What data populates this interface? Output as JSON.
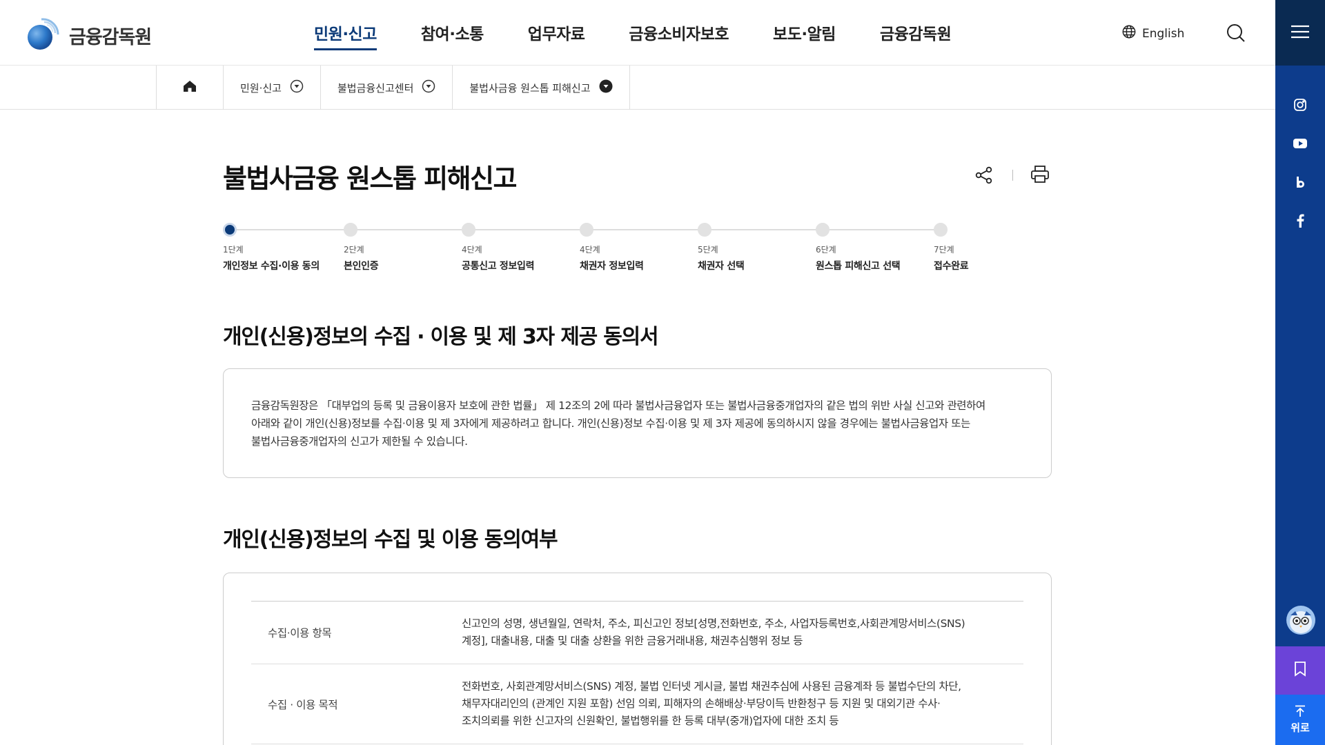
{
  "header": {
    "logo_text": "금융감독원",
    "nav": [
      {
        "label": "민원·신고",
        "active": true
      },
      {
        "label": "참여·소통",
        "active": false
      },
      {
        "label": "업무자료",
        "active": false
      },
      {
        "label": "금융소비자보호",
        "active": false
      },
      {
        "label": "보도·알림",
        "active": false
      },
      {
        "label": "금융감독원",
        "active": false
      }
    ],
    "language": "English"
  },
  "breadcrumb": {
    "items": [
      "민원·신고",
      "불법금융신고센터",
      "불법사금융 원스톱 피해신고"
    ]
  },
  "rail": {
    "top_button_label": "위로"
  },
  "page": {
    "title": "불법사금융 원스톱 피해신고"
  },
  "steps": [
    {
      "num": "1단계",
      "label": "개인정보 수집·이용 동의",
      "active": true
    },
    {
      "num": "2단계",
      "label": "본인인증",
      "active": false
    },
    {
      "num": "4단계",
      "label": "공통신고 정보입력",
      "active": false
    },
    {
      "num": "4단계",
      "label": "채권자 정보입력",
      "active": false
    },
    {
      "num": "5단계",
      "label": "채권자 선택",
      "active": false
    },
    {
      "num": "6단계",
      "label": "원스톱 피해신고 선택",
      "active": false
    },
    {
      "num": "7단계",
      "label": "접수완료",
      "active": false
    }
  ],
  "section1": {
    "heading": "개인(신용)정보의 수집 · 이용 및 제 3자 제공 동의서",
    "lines": [
      "금융감독원장은 「대부업의 등록 및 금융이용자 보호에 관한 법률」 제 12조의 2에 따라 불법사금융업자 또는 불법사금융중개업자의 같은 법의 위반 사실 신고와 관련하여",
      "아래와 같이 개인(신용)정보를 수집·이용 및 제 3자에게 제공하려고 합니다. 개인(신용)정보 수집·이용 및 제 3자 제공에 동의하시지 않을 경우에는 불법사금융업자 또는",
      "불법사금융중개업자의 신고가 제한될 수 있습니다."
    ]
  },
  "section2": {
    "heading": "개인(신용)정보의 수집 및 이용 동의여부",
    "rows": [
      {
        "label": "수집·이용 항목",
        "lines": [
          "신고인의 성명, 생년월일, 연락처, 주소, 피신고인 정보[성명,전화번호, 주소, 사업자등록번호,사회관계망서비스(SNS)",
          "계정], 대출내용, 대출 및 대출 상환을 위한 금융거래내용, 채권추심행위 정보 등"
        ]
      },
      {
        "label": "수집 · 이용 목적",
        "lines": [
          "전화번호, 사회관계망서비스(SNS) 계정, 불법 인터넷 게시글, 불법 채권추심에 사용된 금융계좌 등 불법수단의 차단,",
          "채무자대리인의 (관계인 지원 포함) 선임 의뢰, 피해자의 손해배상·부당이득 반환청구 등 지원 및 대외기관 수사·",
          "조치의뢰를 위한 신고자의 신원확인, 불법행위를 한 등록 대부(중개)업자에 대한 조치 등"
        ]
      }
    ]
  }
}
